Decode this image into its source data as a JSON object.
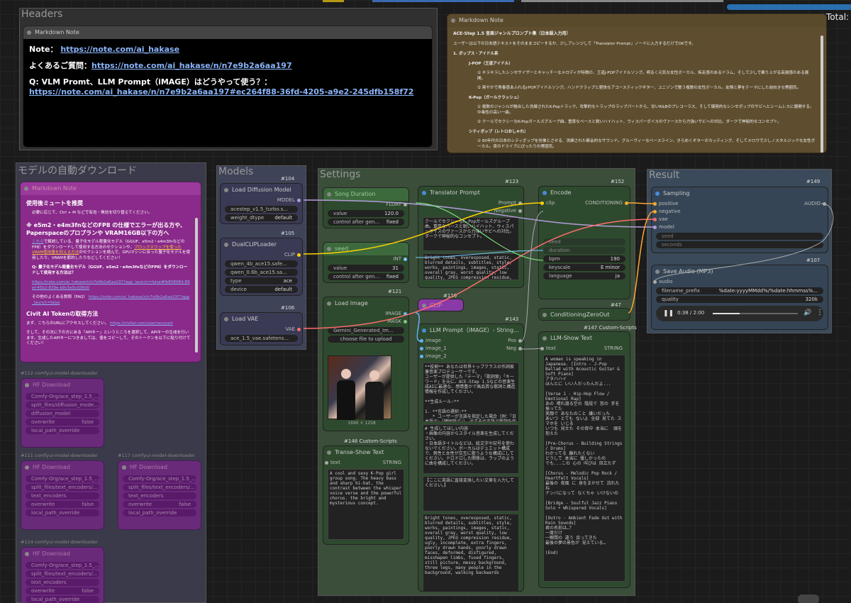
{
  "total_label": "Total:",
  "headers": {
    "group": "Headers",
    "title": "Markdown Note",
    "note_label": "Note：",
    "note_link": "https://note.com/ai_hakase",
    "faq_label": "よくあるご質問：",
    "faq_link": "https://note.com/ai_hakase/n/n7e9b2a6aa197",
    "q_label": "Q: VLM Promt、LLM Prompt（iMAGE）はどうやって使う？：",
    "q_link": "https://note.com/ai_hakase/n/n7e9b2a6aa197#ec264f88-36fd-4205-a9e2-245dfb158f72"
  },
  "ace": {
    "title": "Markdown Note",
    "heading": "ACE-Step 1.5 音楽ジャンルプロンプト集（日本語入力用）",
    "intro": "ユーザーは以下の日本語テキストをそのままコピーするか、少しアレンジして「Translator Prompt」ノードに入力するだけでOKです。",
    "section": "1. ポップス・アイドル系",
    "items": [
      {
        "head": "J-POP（王道アイドル）",
        "lines": [
          "① キラキラしたシンセサイザーとキャッチーなメロディが特徴の、王道J-POPアイドルソング。明るく元気な女性ボーカル、疾走感のあるドラム、そして少しで乗り上がる高揚感のある展開。",
          "② 爽やかで青春感あふれるJ-POPアイドルソング。ハンドクラップと軽快なアコースティックギター、ユニゾンで歌う複数の女性ボーカル。友情と夢をテーマにした前向きな雰囲気。"
        ]
      },
      {
        "head": "K-Pop（ガールクラッシュ）",
        "lines": [
          "① 複数のジャンルが融合した洗練されたK-Popトラック。攻撃的なトラップのラップパートから、甘いR&Bのプレコーラス、そして爆発的なシンセポップのサビへとシームレスに展開する。中毒性の高い一曲。",
          "② クールでセクシーなK-Popガールズグループ曲。重厚なベースと鋭いハイハット、ウィスパーボイスのヴァースから力強いサビへの対比。ダークで神秘的なコンセプト。"
        ]
      },
      {
        "head": "シティポップ（レトロおしゃれ）",
        "lines": [
          "① 80年代の日本のシティポップを彷彿とさせる、洗練された都会的なサウンド。グルーヴィーなベースライン、きらめくギターのカッティング、そしてメロウで少しノスタルジックな女性ボーカル。夜のドライブにぴったりの雰囲気。"
        ]
      }
    ]
  },
  "dl": {
    "group": "モデルの自動ダウンロード",
    "note_title": "Markdown Note",
    "h1": "使用後ミュートを推奨",
    "b1": "必要に応じて、Ctrl + M などで有効・無効を切り替えてください。",
    "h2": "※ e5m2・e4m3fnなどのFP8 の仕様でエラーが出る方や、Paperspaceのプロプランや VRAM16GB以下の方へ",
    "p2a": "こちら",
    "p2b": "で解説している、量子化モデル軽量化モデル（GGUF、e5m2・e4m3fnなどの FP8）をダウンロードして使用する方法のセクションや、",
    "p2c": "ブロックスワップを使ったVRAM使用量を抑える方法",
    "p2d": "のセクションを読んで、GPUマシンに合った量子化モデルを使用したり、VRAMを節約したりなどしてください！",
    "h3": "Q: 量子化モデル軽量化モデル（GGUF、e5m2・e4m3fnなどのFP8）をダウンロードして使用する方法は？",
    "link3": "https://note.com/ai_hakase/n/n7e9b2a6aa197?app_launch=false#fb858084-89ef-45b2-839e-b9c5e5cd36d0",
    "p4": "その他のよくある質問（FAQ）",
    "link4": "https://note.com/ai_hakase/n/n7e9b2a6aa197?app_launch=false",
    "h5": "Civit AI Tokenの取得方法",
    "p5a": "まず、こちらのURLにアクセスしてください。",
    "link5": "https://civitai.com/user/account",
    "p6": "そして、その次に下の方にある「APIキー」というところを選択して、APIキーの生成を行います。生成したAPIキーにつきましては、値をコピーして、そのトークンを以下に貼り付けてください！",
    "downloaders": [
      {
        "id": "#112 comfyui-model-downloader",
        "title": "HF Download",
        "f": [
          "Comfy-Org/ace_step_1.5_...",
          "split_files/diffusion_mode...",
          "diffusion_model",
          "overwrite",
          "local_path_override"
        ],
        "v": [
          "",
          "",
          "",
          "false",
          ""
        ]
      },
      {
        "id": "#111 comfyui-model-downloader",
        "title": "HF Download",
        "f": [
          "Comfy-Org/ace_step_1.5_...",
          "split_files/text_encoders/...",
          "text_encoders",
          "overwrite",
          "local_path_override"
        ],
        "v": [
          "",
          "",
          "",
          "false",
          ""
        ]
      },
      {
        "id": "#117 comfyui-model-downloader",
        "title": "HF Download",
        "f": [
          "Comfy-Org/ace_step_1.5_...",
          "split_files/text_encoders/...",
          "text_encoders",
          "overwrite",
          "local_path_override"
        ],
        "v": [
          "",
          "",
          "",
          "false",
          ""
        ]
      },
      {
        "id": "#114 comfyui-model-downloader",
        "title": "HF Download",
        "f": [
          "Comfy-Org/ace_step_1.5_...",
          "split_files/text_encoders/...",
          "text_encoders",
          "overwrite",
          "local_path_override"
        ],
        "v": [
          "",
          "",
          "",
          "false",
          ""
        ]
      }
    ]
  },
  "models": {
    "group": "Models",
    "ld": {
      "id": "#104",
      "title": "Load Diffusion Model",
      "out": "MODEL",
      "w1": "acestep_v1.5_turbo.s...",
      "w2l": "weight_dtype",
      "w2v": "default"
    },
    "clip": {
      "id": "#105",
      "title": "DualCLIPLoader",
      "out": "CLIP",
      "w1": "qwen_4b_ace15.safe...",
      "w2": "qwen_0.6b_ace15.sa...",
      "w3l": "type",
      "w3v": "ace",
      "w4l": "device",
      "w4v": "default"
    },
    "vae": {
      "id": "#106",
      "title": "Load VAE",
      "out": "VAE",
      "w1": "ace_1.5_vae.safetens..."
    }
  },
  "settings": {
    "group": "Settings",
    "song": {
      "title": "Song Duration",
      "out": "FLOAT",
      "w1l": "value",
      "w1v": "120.0",
      "w2l": "control after gen...",
      "w2v": "fixed"
    },
    "seed": {
      "title": "seed",
      "out": "INT",
      "w1l": "value",
      "w1v": "31",
      "w2l": "control after gen...",
      "w2v": "fixed"
    },
    "img": {
      "id": "#121",
      "title": "Load Image",
      "o1": "IMAGE",
      "o2": "MASK",
      "file": "Gemini_Generated_Im...",
      "btn": "choose file to upload",
      "dims": "1696 × 1258"
    },
    "tr": {
      "id": "#123",
      "title": "Translator Prompt",
      "o1": "Prompt",
      "o2": "Negative",
      "t1": "クールでセクシーなK-Popガールズグループ曲。重厚なベースと鋭いハイハット、ウィスパーボイスのヴァースから力強いサビへの対比。ダークで神秘的なコンセプト。",
      "t2": "Bright tones, overexposed, static, blurred details, subtitles, style, works, paintings, images, static, overall gray, worst quality, low quality, JPEG compression residue, ugly, incomplete, extra fingers, poorly drawn hands, poorly drawn faces, deformed, disfigured, misshapen limbs, fused fingers, still picture,"
    },
    "n119": "#119",
    "n119t": "CLIP",
    "llm": {
      "id": "#143",
      "title": "LLM Prompt（iMAGE）- String...",
      "i1": "image",
      "i2": "image_1",
      "i3": "image_2",
      "o1": "Pos",
      "o2": "Neg",
      "t1": "**役割** あなたは世界トップクラスの作詞家兼音楽プロデューサーです。\nユーザーが提供した「テーマ」「歌詞案」「キーワード」を元に、ACE-Step 1.5などの音楽生成AIに最適な、感情豊かで高品質な歌詞と構造情報を作成してください。\n\n**生成ルール:**\n\n1. **言語の選択:**\n   * ユーザーが言語を指定した場合（例：「日本語で」「韓国語で」）、必ずその言語で歌詞を作成してください。",
      "t2": "# 生成してほしい内容\n・画像の内容からスタイル音楽を生成してください。\n・日本語タイトルなどは、絵文字や記号を使わないでください。ボーカルはデュエット構成で、男性と女性が交互に歌うような構成にしてください。ドロドロした関係は、ラップのように曲を構成してください。",
      "t3": "【ここに英語に直接変換したい文章を入力してください。】",
      "t4": "Bright tones, overexposed, static, blurred details, subtitles, style, works, paintings, images, static, overall gray, worst quality, low quality, JPEG compression residue, ugly, incomplete, extra fingers, poorly drawn hands, poorly drawn faces, deformed, disfigured, misshapen limbs, fused fingers, still picture, messy background, three legs, many people in the background, walking backwards"
    },
    "enc": {
      "id": "#152",
      "title": "Encode",
      "in": "clip",
      "out": "CONDITIONING",
      "s1": "seed",
      "s2": "duration",
      "w1l": "bpm",
      "w1v": "190",
      "w2l": "keyscale",
      "w2v": "E minor",
      "w3l": "language",
      "w3v": "ja"
    },
    "czo": {
      "id": "#47",
      "title": "ConditioningZeroOut"
    },
    "tshow": {
      "id": "#148 Custom-Scripts",
      "title": "Transe-Show Text",
      "in": "text",
      "out": "STRING",
      "txt": "A cool and sexy K-Pop girl group song. The heavy bass and sharp hi-hat, the contrast between the whisper voice verse and the powerful chorus. the bright and mysterious concept."
    },
    "lshow": {
      "id": "#147 Custom-Scripts",
      "title": "LLM-Show Text",
      "in": "text",
      "out": "STRING",
      "txt": "A woman is speaking in Japanese. [Intro - J-Pop Ballad with Acoustic Guitar & Soft Piano]\nアタハハイ\nほんとに いい人だったんだよ...\n\n[Verse 1 - Hip-Hop Flow / Emotional Rap]\nあの 晴れ渡る空の 階段で 窓の 手を 振ってた\n笑顔で あなたのこと 嫌いだった\nあいつ とても ないよ 全部 見てた スマホを いじる\nいつも 見せた その背中 本当に  頭を抱えた\n\n[Pre-Chorus - Building Strings / Drums]\nわかってる 離れたくない\nどうして 本当に 優しかったの\nでも...この 心の 叫びは 目立たず\n\n[Chorus - Melodic Pop Rock / Heartfelt Vocals]\n最後の 夜風 に 身をまかせて 流れたね\nナンバになって なくちゃ いけないの\n\n[Bridge - Soulful Jazz Piano Solo + Whispered Vocals]\n\n[Outro - Ambient Fade Out with Rain Sounds]\n君の名前は…？\n一度だけ\n一瞬間の 違う 戻ってきた\n最後の夢の景色が 見えている…\n\n(End)"
    }
  },
  "result": {
    "group": "Result",
    "samp": {
      "id": "#149",
      "title": "Sampling",
      "i": [
        "positive",
        "negative",
        "vae",
        "model"
      ],
      "s": [
        "seed",
        "seconds"
      ],
      "out": "AUDIO"
    },
    "save": {
      "id": "#107",
      "title": "Save Audio (MP3)",
      "in": "audio",
      "w1l": "filename_prefix",
      "w1v": "%date:yyyyMMdd%/%date:hhmmss%...",
      "w2l": "quality",
      "w2v": "320k",
      "time": "0:38 / 2:00",
      "progress": 0.32
    }
  },
  "colors": {
    "settings_bg": "#3a4e3a",
    "models_bg": "#3f4358",
    "dl_bg": "#3a3a4a",
    "purple": "#8a2a8a",
    "ace_bg": "#5e4e2f",
    "result_bg": "#3a4a5a"
  }
}
